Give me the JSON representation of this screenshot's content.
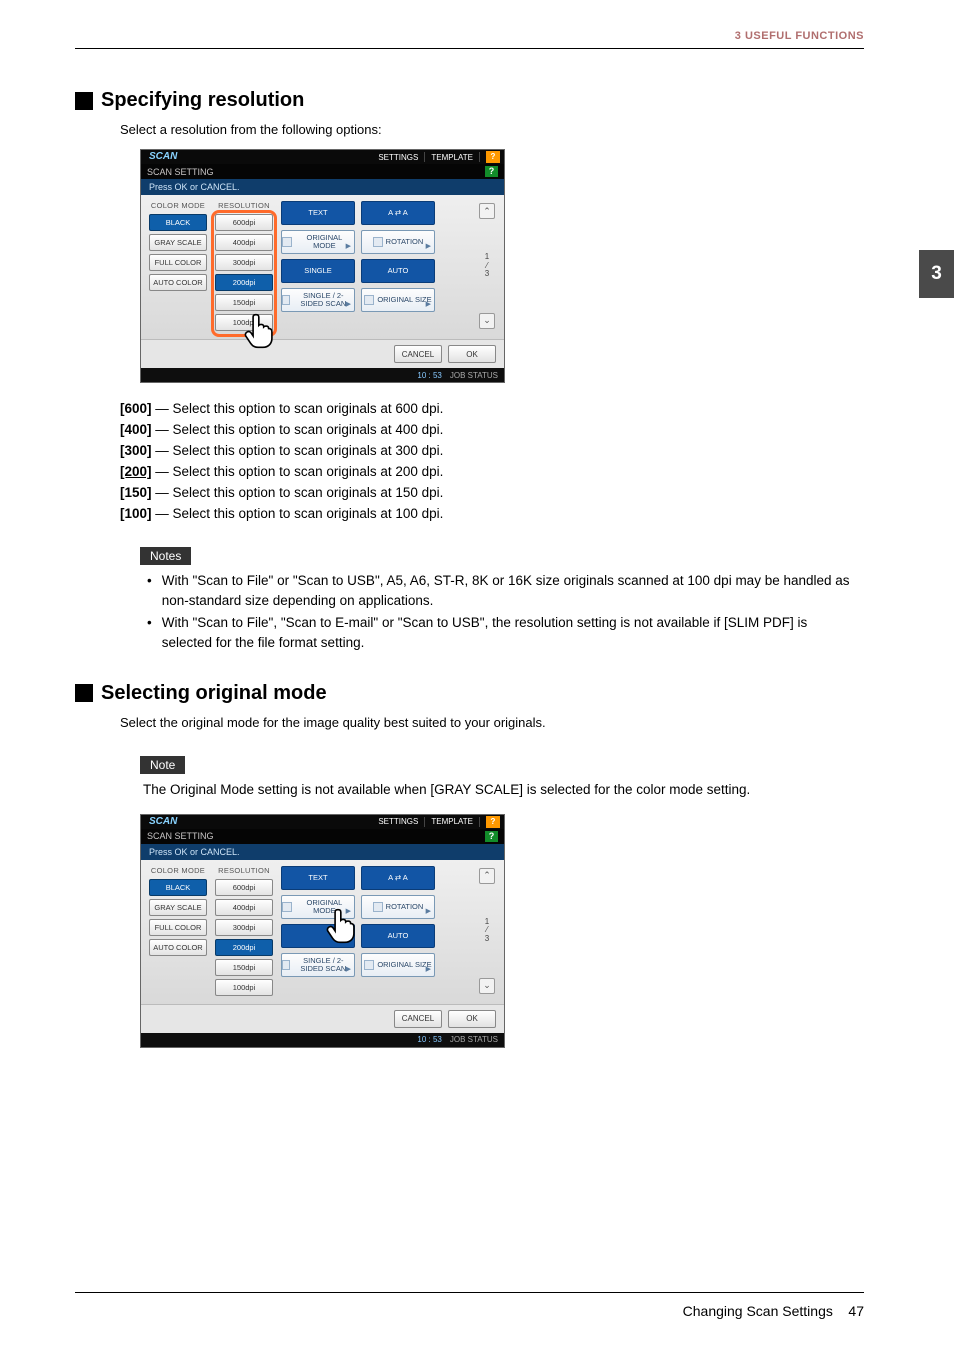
{
  "header": {
    "running": "3 USEFUL FUNCTIONS"
  },
  "chapter_tab": "3",
  "section1": {
    "title": "Specifying resolution",
    "intro": "Select a resolution from the following options:",
    "options": [
      {
        "label": "[600]",
        "desc": " — Select this option to scan originals at 600 dpi."
      },
      {
        "label": "[400]",
        "desc": " — Select this option to scan originals at 400 dpi."
      },
      {
        "label": "[300]",
        "desc": " — Select this option to scan originals at 300 dpi."
      },
      {
        "label": "[200]",
        "desc": " — Select this option to scan originals at 200 dpi.",
        "underline": true
      },
      {
        "label": "[150]",
        "desc": " — Select this option to scan originals at 150 dpi."
      },
      {
        "label": "[100]",
        "desc": " — Select this option to scan originals at 100 dpi."
      }
    ],
    "notes_label": "Notes",
    "notes": [
      "With \"Scan to File\" or \"Scan to USB\", A5, A6, ST-R, 8K or 16K size originals scanned at 100 dpi may be handled as non-standard size depending on applications.",
      "With \"Scan to File\", \"Scan to E-mail\" or \"Scan to USB\", the resolution setting is not available if [SLIM PDF] is selected for the file format setting."
    ]
  },
  "section2": {
    "title": "Selecting original mode",
    "intro": "Select the original mode for the image quality best suited to your originals.",
    "note_label": "Note",
    "note": "The Original Mode setting is not available when [GRAY SCALE] is selected for the color mode setting."
  },
  "screenshot": {
    "topbar": {
      "scan": "SCAN",
      "settings": "SETTINGS",
      "template": "TEMPLATE",
      "help": "?"
    },
    "subbar": {
      "title": "SCAN SETTING",
      "help": "?"
    },
    "instruction": "Press OK or CANCEL.",
    "color_mode_label": "COLOR MODE",
    "color_modes": [
      "BLACK",
      "GRAY SCALE",
      "FULL COLOR",
      "AUTO COLOR"
    ],
    "resolution_label": "RESOLUTION",
    "resolutions": [
      "600dpi",
      "400dpi",
      "300dpi",
      "200dpi",
      "150dpi",
      "100dpi"
    ],
    "selected_resolution": "200dpi",
    "right_options": {
      "r0c0": "TEXT",
      "r0c1": "A ⇄ A",
      "r1c0": "ORIGINAL MODE",
      "r1c1": "ROTATION",
      "r2c0": "SINGLE",
      "r2c1": "AUTO",
      "r3c0": "SINGLE / 2-SIDED SCAN",
      "r3c1": "ORIGINAL SIZE"
    },
    "scroll": {
      "cur": "1",
      "total": "3"
    },
    "footer": {
      "cancel": "CANCEL",
      "ok": "OK"
    },
    "status": {
      "time": "10 : 53",
      "label": "JOB STATUS"
    }
  },
  "footer": {
    "text": "Changing Scan Settings",
    "page": "47"
  }
}
